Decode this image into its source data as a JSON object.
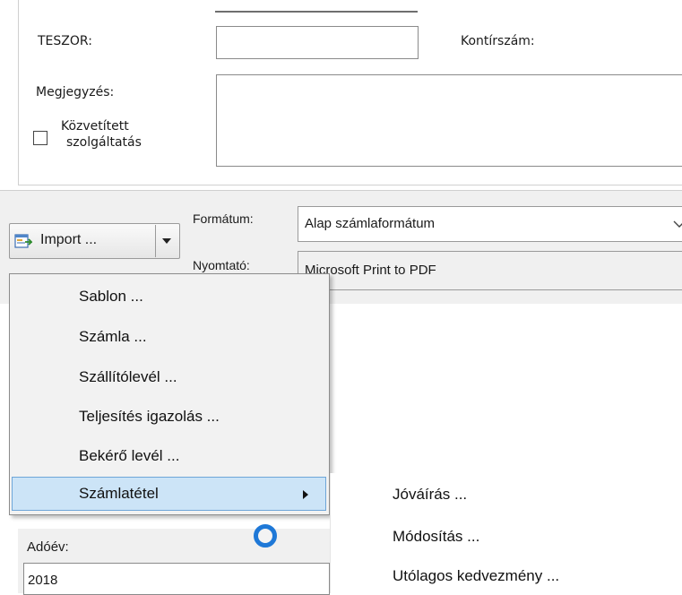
{
  "form": {
    "teszor_label": "TESZOR:",
    "kontir_label": "Kontírszám:",
    "megjegyzes_label": "Megjegyzés:",
    "kozvetitett_line1": "Közvetített",
    "kozvetitett_line2": "szolgáltatás"
  },
  "toolbar": {
    "import_label": "Import ...",
    "format_label": "Formátum:",
    "format_value": "Alap számlaformátum",
    "printer_label": "Nyomtató:",
    "printer_value": "Microsoft Print to PDF"
  },
  "menu": {
    "items": [
      {
        "label": "Sablon ..."
      },
      {
        "label": "Számla ..."
      },
      {
        "label": "Szállítólevél ..."
      },
      {
        "label": "Teljesítés igazolás ..."
      },
      {
        "label": "Bekérő levél ..."
      },
      {
        "label": "Számlatétel",
        "selected": true,
        "has_submenu": true
      }
    ]
  },
  "submenu": {
    "items": [
      {
        "label": "Jóváírás ..."
      },
      {
        "label": "Módosítás ..."
      },
      {
        "label": "Utólagos kedvezmény ..."
      }
    ]
  },
  "year": {
    "label": "Adóév:",
    "value": "2018"
  },
  "colors": {
    "selection_bg": "#cce4f7",
    "selection_border": "#6ea6d9",
    "cursor_ring": "#1e78d7"
  },
  "icons": [
    "import-icon",
    "dropdown-arrow-icon",
    "chevron-down-icon",
    "submenu-arrow-icon",
    "busy-cursor-icon"
  ]
}
